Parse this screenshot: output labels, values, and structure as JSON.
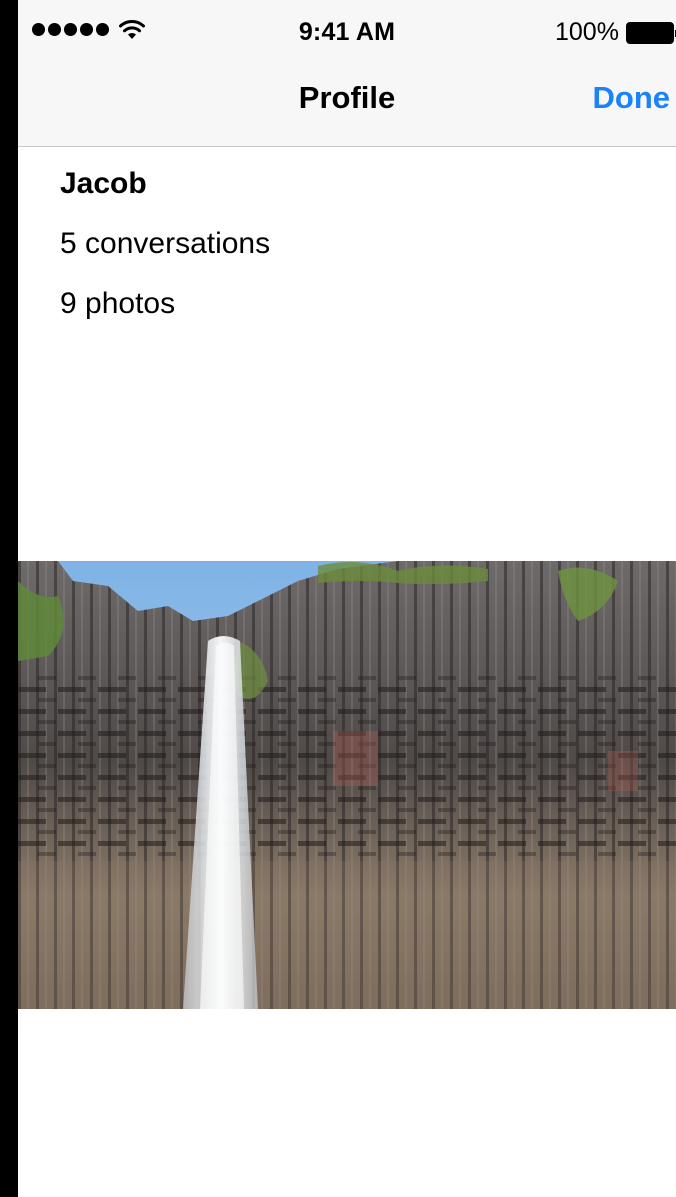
{
  "status_bar": {
    "time": "9:41 AM",
    "battery_percent": "100%",
    "signal_bars": 5,
    "icons": [
      "signal-dots-icon",
      "wifi-icon",
      "battery-icon"
    ]
  },
  "nav": {
    "title": "Profile",
    "done_label": "Done"
  },
  "profile": {
    "name": "Jacob",
    "conversations": "5 conversations",
    "photos": "9 photos"
  },
  "photo": {
    "subject": "waterfall over basalt columns"
  },
  "colors": {
    "accent": "#1a82fb",
    "bar_background": "#f7f7f7",
    "separator": "#c8c7cc"
  }
}
